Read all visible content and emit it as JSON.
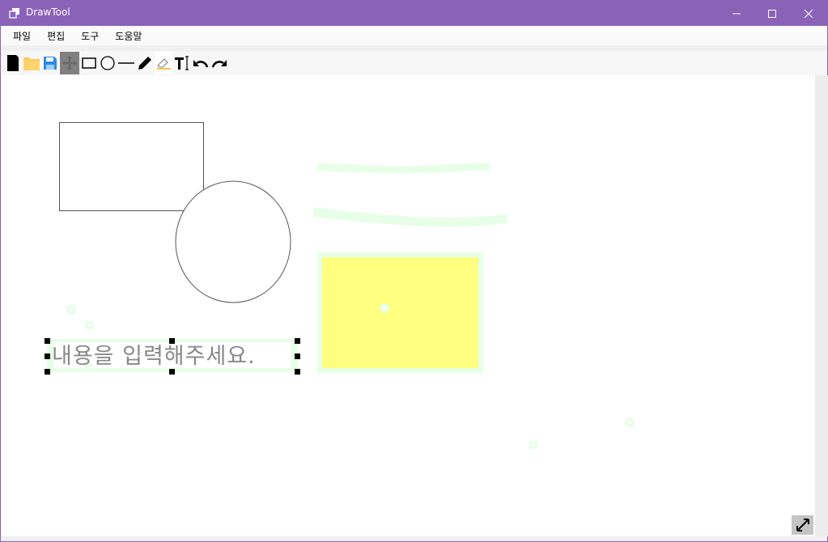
{
  "window": {
    "title": "DrawTool"
  },
  "menu": [
    {
      "label": "파일"
    },
    {
      "label": "편집"
    },
    {
      "label": "도구"
    },
    {
      "label": "도움말"
    }
  ],
  "toolbar": {
    "tools": [
      "new",
      "open",
      "save",
      "move",
      "rectangle",
      "ellipse",
      "line",
      "pen",
      "eraser",
      "text",
      "undo",
      "redo"
    ],
    "selected": "move"
  },
  "canvas": {
    "text_placeholder": "내용을 입력해주세요.",
    "colors": {
      "fill": "#ffff80",
      "highlight": "#e6ffe6",
      "accent": "#8a63b8"
    }
  }
}
